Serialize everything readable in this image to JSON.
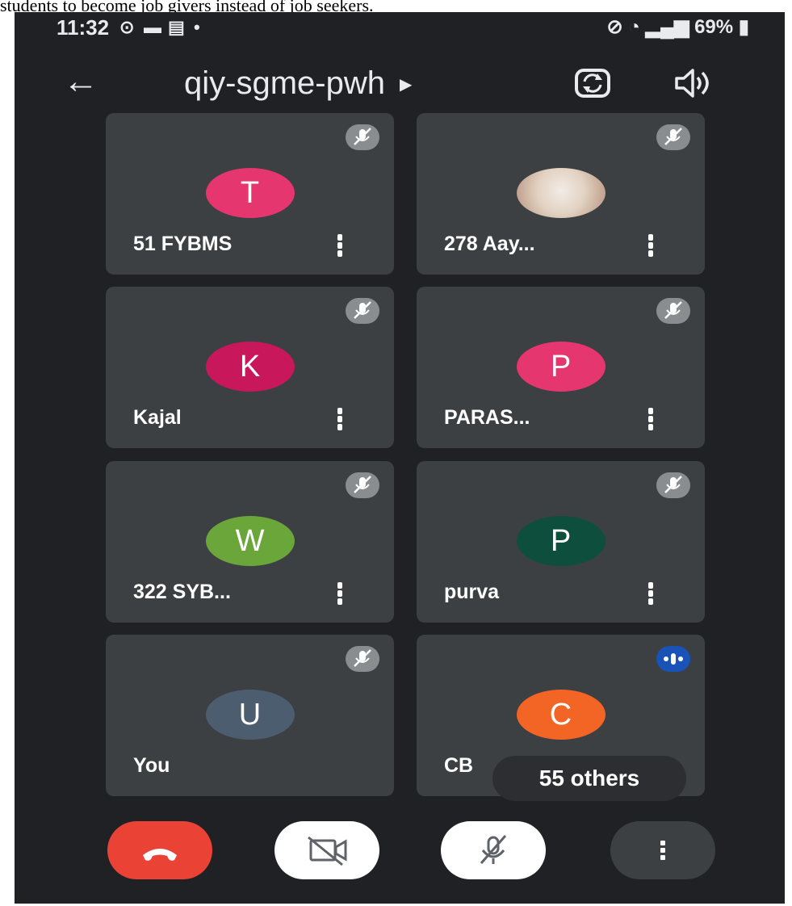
{
  "caption": "students to become job givers instead of job seekers.",
  "status_bar": {
    "time": "11:32",
    "battery": "69%"
  },
  "header": {
    "meeting_code": "qiy-sgme-pwh"
  },
  "participants": [
    {
      "name": "51 FYBMS",
      "initial": "T",
      "color": "#e6366f"
    },
    {
      "name": "278 Aay...",
      "initial": "",
      "color": "#d9c9b8"
    },
    {
      "name": "Kajal",
      "initial": "K",
      "color": "#c8185b"
    },
    {
      "name": "PARAS...",
      "initial": "P",
      "color": "#e6366f"
    },
    {
      "name": "322 SYB...",
      "initial": "W",
      "color": "#6aa63a"
    },
    {
      "name": "purva",
      "initial": "P",
      "color": "#0d4f3c"
    },
    {
      "name": "You",
      "initial": "U",
      "color": "#4d5d70"
    },
    {
      "name": "CB",
      "initial": "C",
      "color": "#f26524"
    }
  ],
  "others_chip": "55 others",
  "colors": {
    "end_call": "#ea4335",
    "background": "#202124",
    "tile": "#3c4043"
  }
}
